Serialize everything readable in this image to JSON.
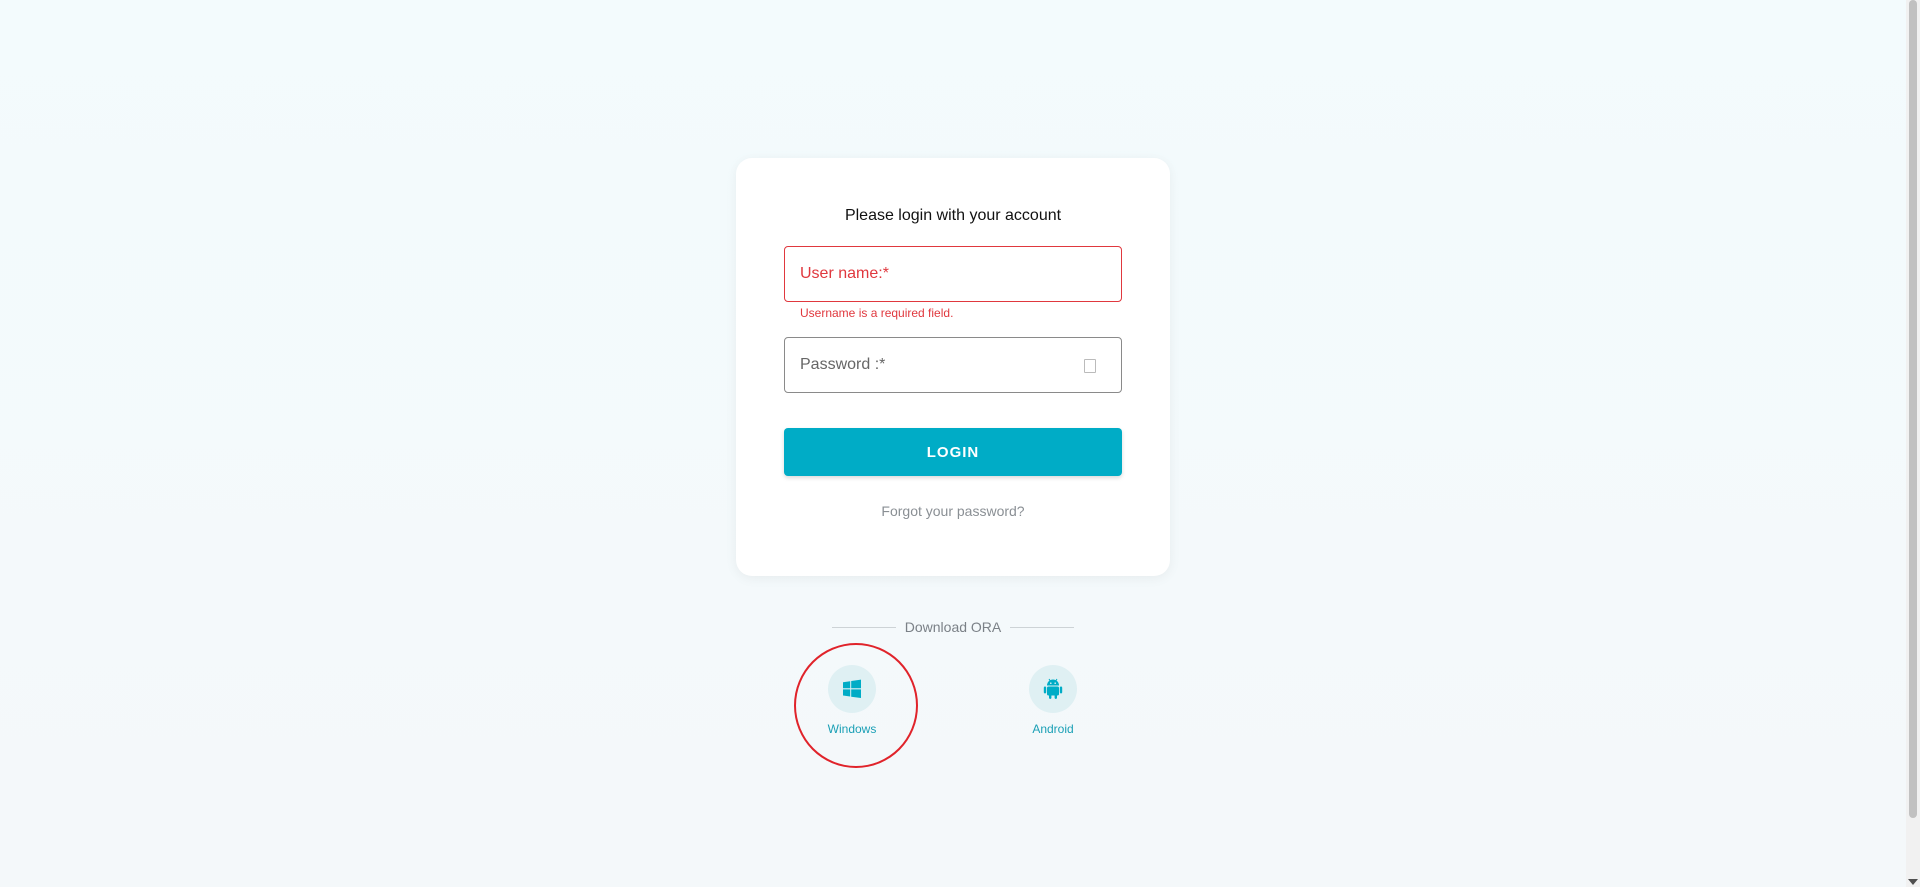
{
  "login": {
    "title": "Please login with your account",
    "username_label": "User name:*",
    "username_error": "Username is a required field.",
    "password_label": "Password :*",
    "login_button": "LOGIN",
    "forgot_link": "Forgot your password?"
  },
  "download": {
    "heading": "Download ORA",
    "items": [
      {
        "label": "Windows",
        "icon": "windows-icon"
      },
      {
        "label": "Android",
        "icon": "android-icon"
      }
    ]
  },
  "colors": {
    "accent": "#00acc6",
    "error": "#e0383e",
    "highlight": "#e0232a"
  }
}
